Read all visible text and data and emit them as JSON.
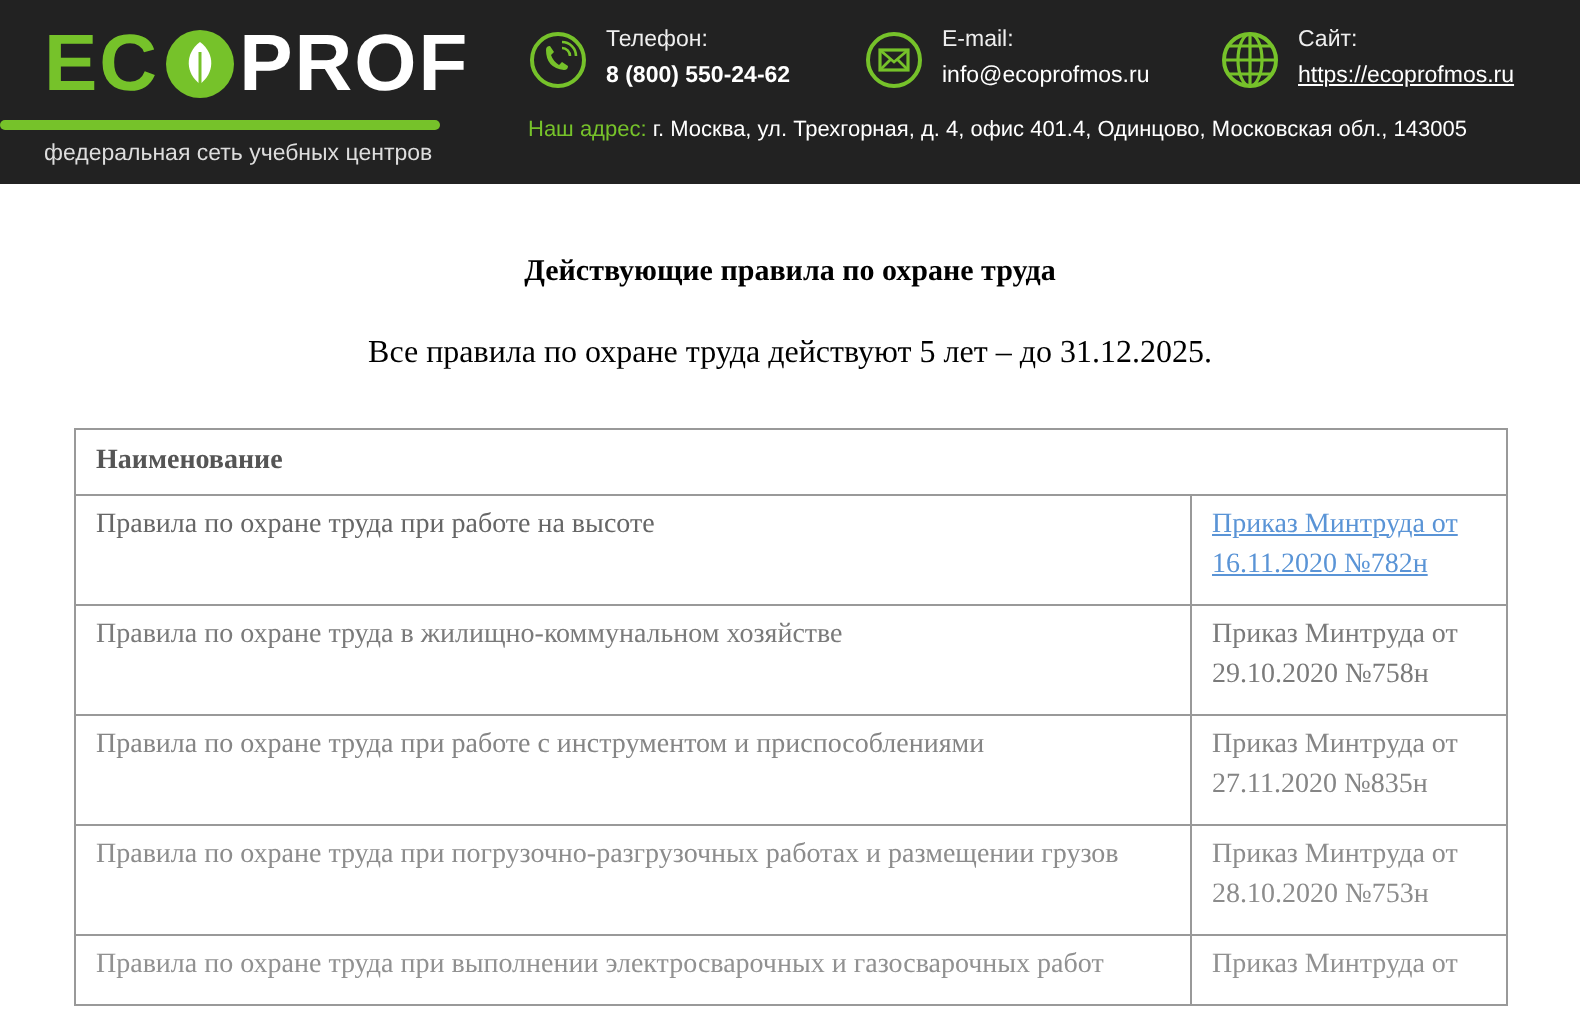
{
  "header": {
    "logo": {
      "left": "EC",
      "right": "PROF"
    },
    "tagline": "федеральная сеть учебных центров",
    "contacts": [
      {
        "kind": "phone",
        "label": "Телефон:",
        "value": "8 (800) 550-24-62",
        "link": false
      },
      {
        "kind": "mail",
        "label": "E-mail:",
        "value": "info@ecoprofmos.ru",
        "link": false
      },
      {
        "kind": "globe",
        "label": "Сайт:",
        "value": "https://ecoprofmos.ru",
        "link": true
      }
    ],
    "address": {
      "label": "Наш адрес:",
      "value": "г. Москва, ул. Трехгорная, д. 4, офис 401.4, Одинцово, Московская обл., 143005"
    }
  },
  "title": "Действующие правила по охране труда",
  "subtitle": "Все правила по охране труда действуют 5 лет – до 31.12.2025.",
  "table": {
    "columns": [
      "Наименование"
    ],
    "rows": [
      {
        "name": "Правила по охране труда при работе на высоте",
        "order": "Приказ Минтруда от 16.11.2020 №782н",
        "link": true
      },
      {
        "name": "Правила по охране труда в жилищно-коммунальном хозяйстве",
        "order": "Приказ Минтруда от 29.10.2020 №758н",
        "link": false
      },
      {
        "name": "Правила по охране труда при работе с инструментом и приспособлениями",
        "order": "Приказ Минтруда от 27.11.2020 №835н",
        "link": false
      },
      {
        "name": "Правила по охране труда при погрузочно-разгрузочных работах и размещении грузов",
        "order": "Приказ Минтруда от 28.10.2020 №753н",
        "link": false
      },
      {
        "name": "Правила по охране труда при выполнении электросварочных и газосварочных работ",
        "order": "Приказ Минтруда от",
        "link": false
      }
    ]
  }
}
